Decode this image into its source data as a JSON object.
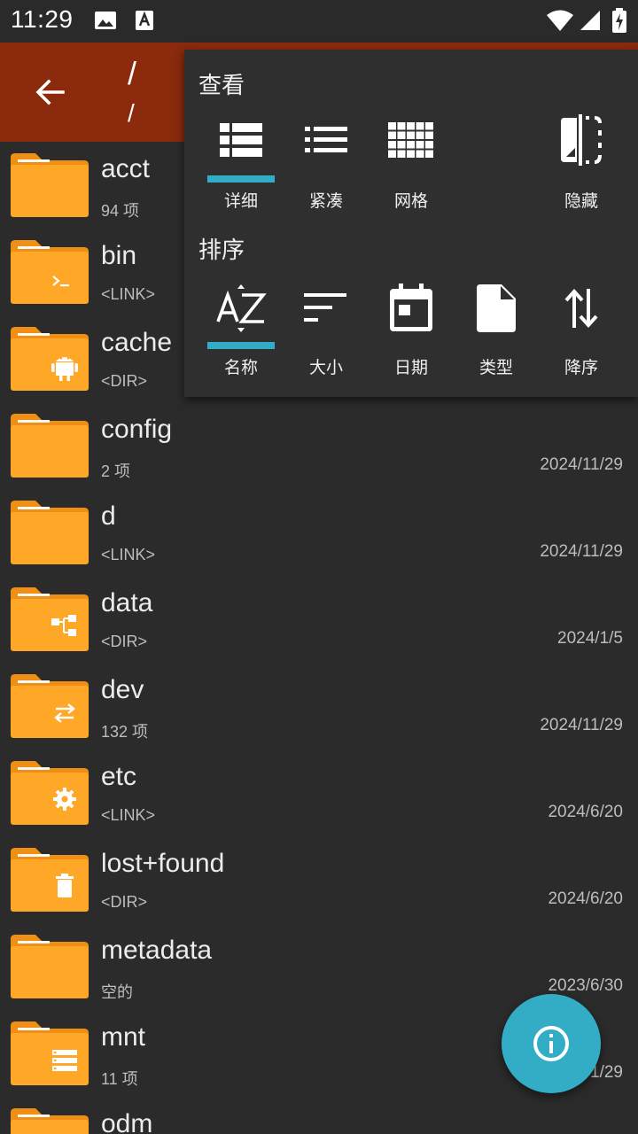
{
  "status_bar": {
    "time": "11:29"
  },
  "app_bar": {
    "title": "/",
    "subtitle": "/"
  },
  "files": [
    {
      "name": "acct",
      "meta": "94 项",
      "date": "",
      "badge": "none"
    },
    {
      "name": "bin",
      "meta": "<LINK>",
      "date": "",
      "badge": "terminal-icon"
    },
    {
      "name": "cache",
      "meta": "<DIR>",
      "date": "",
      "badge": "android-icon"
    },
    {
      "name": "config",
      "meta": "2 项",
      "date": "2024/11/29",
      "badge": "none"
    },
    {
      "name": "d",
      "meta": "<LINK>",
      "date": "2024/11/29",
      "badge": "none"
    },
    {
      "name": "data",
      "meta": "<DIR>",
      "date": "2024/1/5",
      "badge": "tree-icon"
    },
    {
      "name": "dev",
      "meta": "132 项",
      "date": "2024/11/29",
      "badge": "swap-icon"
    },
    {
      "name": "etc",
      "meta": "<LINK>",
      "date": "2024/6/20",
      "badge": "gear-icon"
    },
    {
      "name": "lost+found",
      "meta": "<DIR>",
      "date": "2024/6/20",
      "badge": "trash-icon"
    },
    {
      "name": "metadata",
      "meta": "空的",
      "date": "2023/6/30",
      "badge": "none"
    },
    {
      "name": "mnt",
      "meta": "11 项",
      "date": "1/29",
      "badge": "storage-icon"
    },
    {
      "name": "odm",
      "meta": "",
      "date": "",
      "badge": "none"
    }
  ],
  "menu": {
    "view_title": "查看",
    "view_options": [
      {
        "label": "详细",
        "icon": "view-detail-icon",
        "selected": true
      },
      {
        "label": "紧凑",
        "icon": "view-compact-icon",
        "selected": false
      },
      {
        "label": "网格",
        "icon": "view-grid-icon",
        "selected": false
      },
      {
        "label": "隐藏",
        "icon": "hidden-files-icon",
        "selected": false
      }
    ],
    "sort_title": "排序",
    "sort_options": [
      {
        "label": "名称",
        "icon": "sort-by-name-icon",
        "selected": true
      },
      {
        "label": "大小",
        "icon": "sort-by-size-icon",
        "selected": false
      },
      {
        "label": "日期",
        "icon": "sort-by-date-icon",
        "selected": false
      },
      {
        "label": "类型",
        "icon": "sort-by-type-icon",
        "selected": false
      },
      {
        "label": "降序",
        "icon": "sort-order-icon",
        "selected": false
      }
    ]
  },
  "fab": {
    "icon": "info-icon"
  },
  "colors": {
    "app_bar": "#8b2a0c",
    "folder": "#ffa726",
    "accent": "#33acc6",
    "background": "#2b2b2b"
  }
}
